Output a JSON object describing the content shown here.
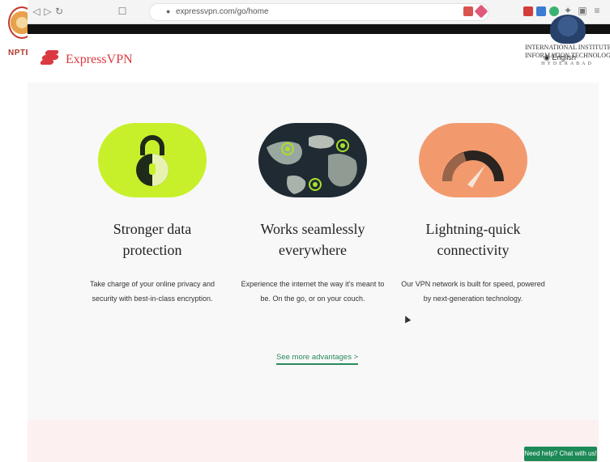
{
  "overlay": {
    "nptel_label": "NPTEL",
    "institute_line1": "INTERNATIONAL INSTITUTE OF",
    "institute_line2": "INFORMATION TECHNOLOGY",
    "institute_city": "HYDERABAD"
  },
  "browser": {
    "url": "expressvpn.com/go/home",
    "back_icon": "back-arrow-icon",
    "forward_icon": "forward-arrow-icon",
    "reload_icon": "reload-icon"
  },
  "site": {
    "brand": "ExpressVPN",
    "brand_color": "#da3940",
    "language": "English"
  },
  "features": [
    {
      "title_line1": "Stronger data",
      "title_line2": "protection",
      "desc_line1": "Take charge of your online privacy and",
      "desc_line2": "security with best-in-class encryption.",
      "color": "#c8f02a",
      "icon": "padlock-icon"
    },
    {
      "title_line1": "Works seamlessly",
      "title_line2": "everywhere",
      "desc_line1": "Experience the internet the way it's meant to",
      "desc_line2": "be. On the go, or on your couch.",
      "color": "#1f2a33",
      "icon": "globe-icon"
    },
    {
      "title_line1": "Lightning-quick",
      "title_line2": "connectivity",
      "desc_line1": "Our VPN network is built for speed, powered",
      "desc_line2": "by next-generation technology.",
      "color": "#f29a6e",
      "icon": "speedometer-icon"
    }
  ],
  "see_more": "See more advantages >",
  "chat_button": "Need help? Chat with us!"
}
